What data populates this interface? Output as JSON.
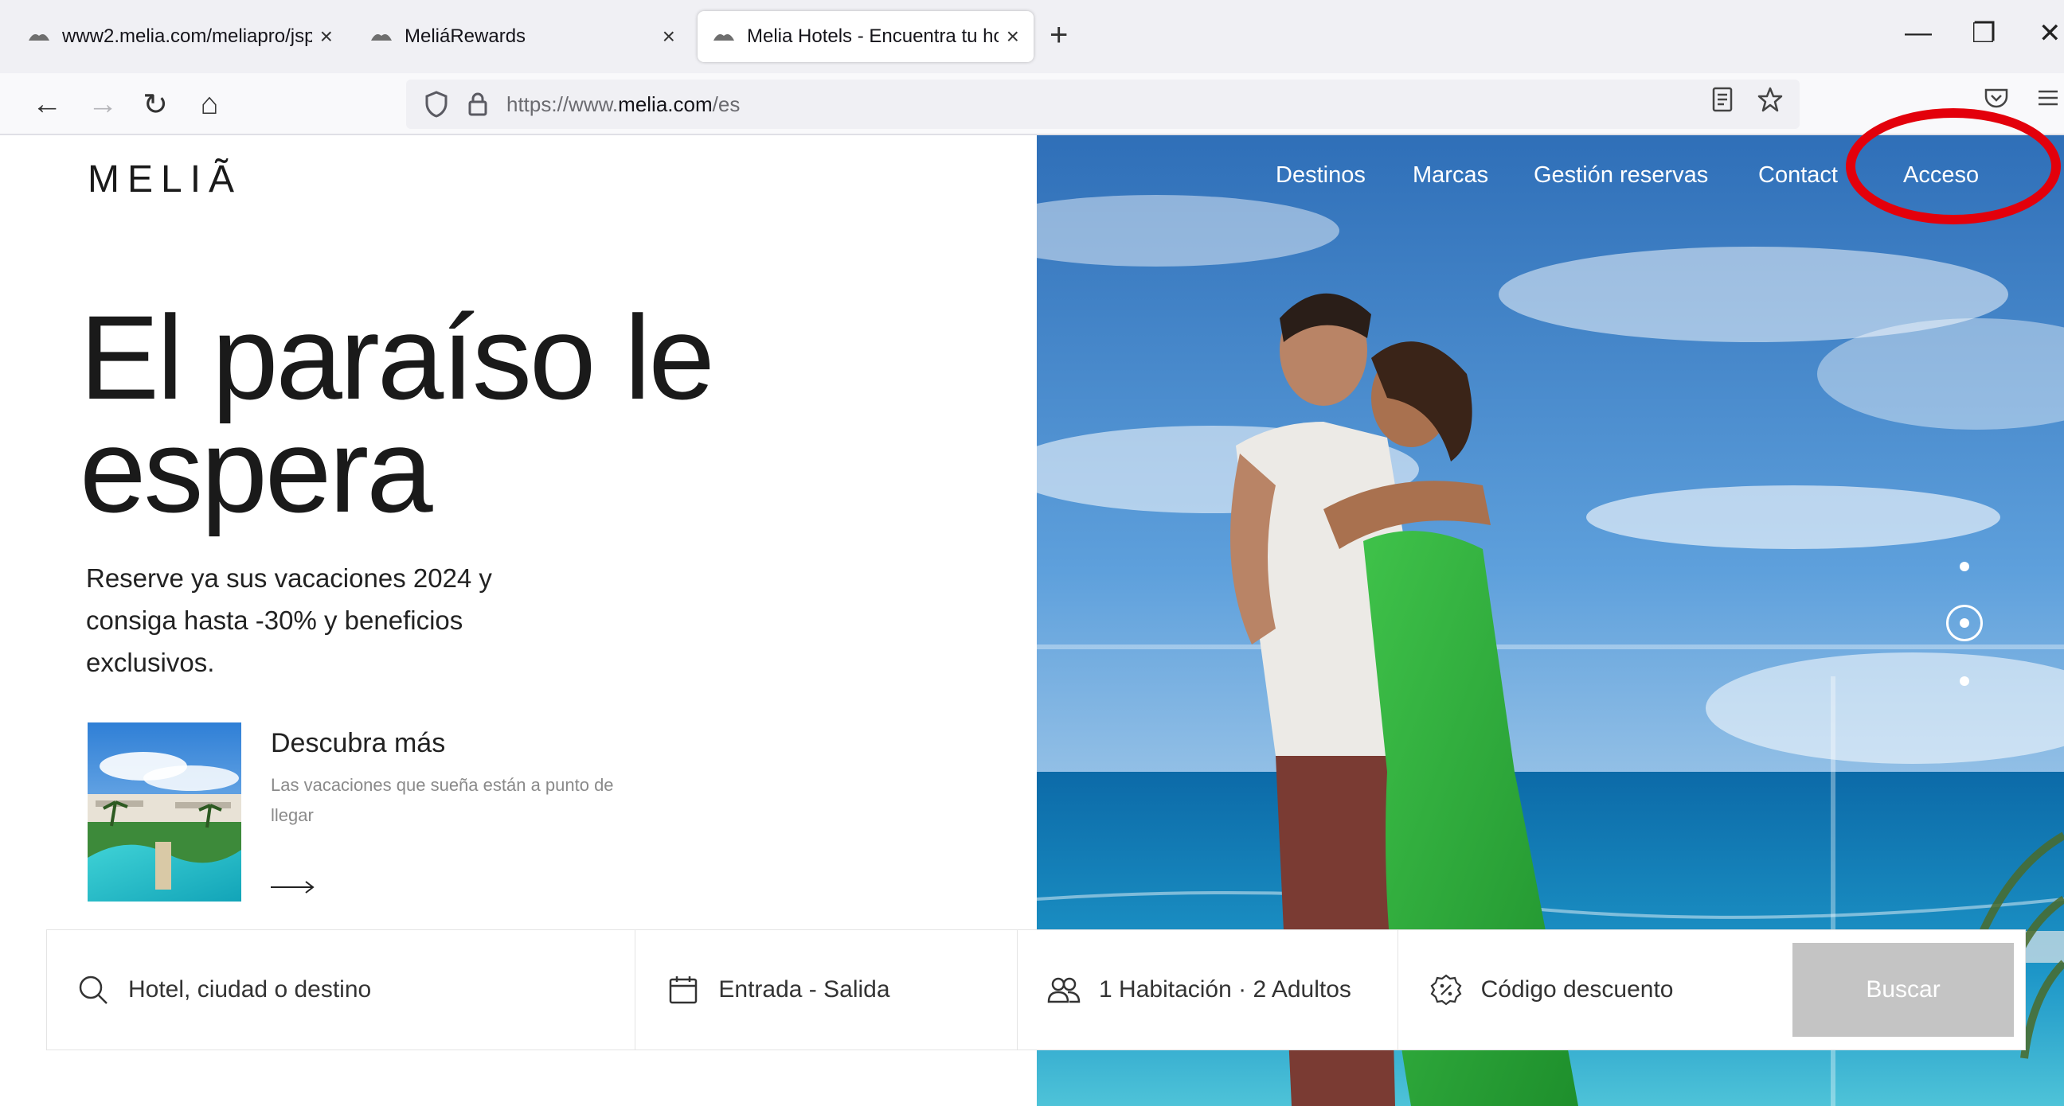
{
  "browser": {
    "tabs": [
      {
        "title": "www2.melia.com/meliapro/jsp/",
        "active": false
      },
      {
        "title": "MeliáRewards",
        "active": false
      },
      {
        "title": "Melia Hotels - Encuentra tu hot",
        "active": true
      }
    ],
    "new_tab_glyph": "+",
    "close_glyph": "×",
    "window_controls": {
      "minimize": "—",
      "restore": "❐",
      "close": "✕"
    },
    "nav": {
      "back": "←",
      "forward": "→",
      "reload": "↻",
      "home": "⌂"
    },
    "url": {
      "prefix": "https://www.",
      "domain": "melia.com",
      "path": "/es"
    },
    "icons": [
      "shield-icon",
      "lock-icon",
      "reader-view-icon",
      "bookmark-star-icon",
      "pocket-icon",
      "menu-icon"
    ]
  },
  "site": {
    "logo": "MELIÃ",
    "nav": [
      {
        "label": "Destinos"
      },
      {
        "label": "Marcas"
      },
      {
        "label": "Gestión reservas"
      },
      {
        "label": "Contact"
      },
      {
        "label": "Acceso"
      }
    ],
    "highlight_color": "#e3000b"
  },
  "hero": {
    "title_line1": "El paraíso le",
    "title_line2": "espera",
    "subtitle": "Reserve ya sus vacaciones 2024 y consiga hasta -30% y beneficios exclusivos.",
    "promo": {
      "title": "Descubra más",
      "description": "Las vacaciones que sueña están a punto de llegar"
    },
    "carousel_active": 2,
    "carousel_count": 3
  },
  "search": {
    "destination_placeholder": "Hotel, ciudad o destino",
    "dates_label": "Entrada - Salida",
    "guests_label": "1 Habitación · 2 Adultos",
    "discount_label": "Código descuento",
    "submit_label": "Buscar"
  },
  "colors": {
    "tab_strip": "#f0f0f4",
    "search_button": "#c4c4c4",
    "text": "#1a1a1a"
  }
}
